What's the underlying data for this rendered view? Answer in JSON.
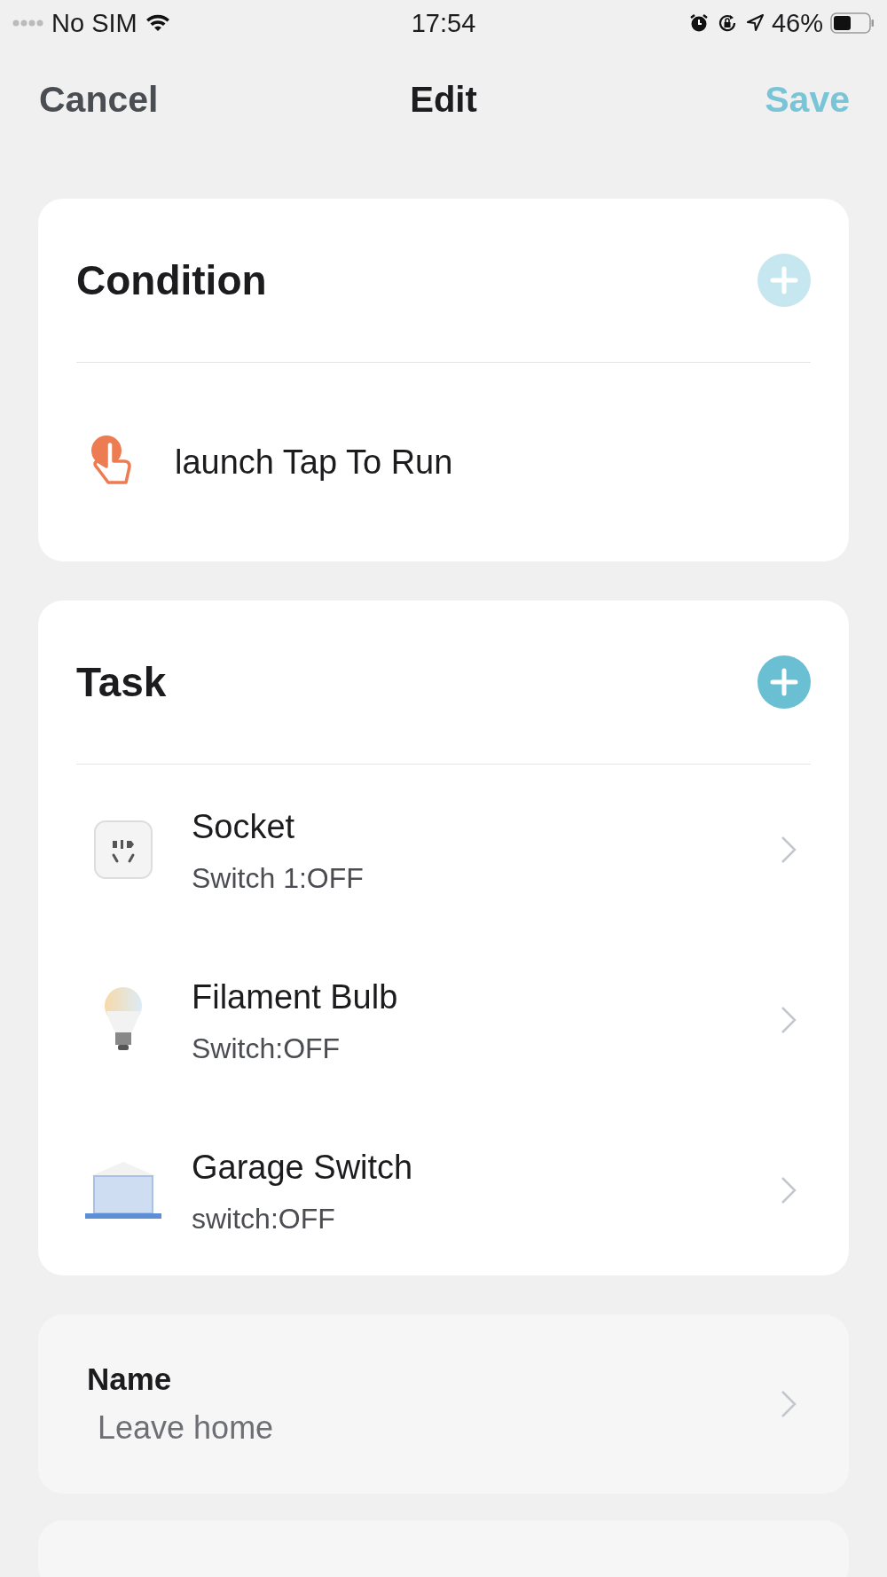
{
  "status_bar": {
    "carrier": "No SIM",
    "time": "17:54",
    "battery": "46%"
  },
  "nav": {
    "cancel": "Cancel",
    "title": "Edit",
    "save": "Save"
  },
  "condition": {
    "title": "Condition",
    "add_disabled": true,
    "items": [
      {
        "kind": "tap",
        "label": "launch Tap To Run"
      }
    ]
  },
  "task": {
    "title": "Task",
    "add_disabled": false,
    "items": [
      {
        "kind": "socket",
        "name": "Socket",
        "detail": "Switch 1:OFF"
      },
      {
        "kind": "bulb",
        "name": "Filament Bulb",
        "detail": "Switch:OFF"
      },
      {
        "kind": "garage",
        "name": "Garage Switch",
        "detail": "switch:OFF"
      }
    ]
  },
  "name_field": {
    "label": "Name",
    "value": "Leave home"
  }
}
